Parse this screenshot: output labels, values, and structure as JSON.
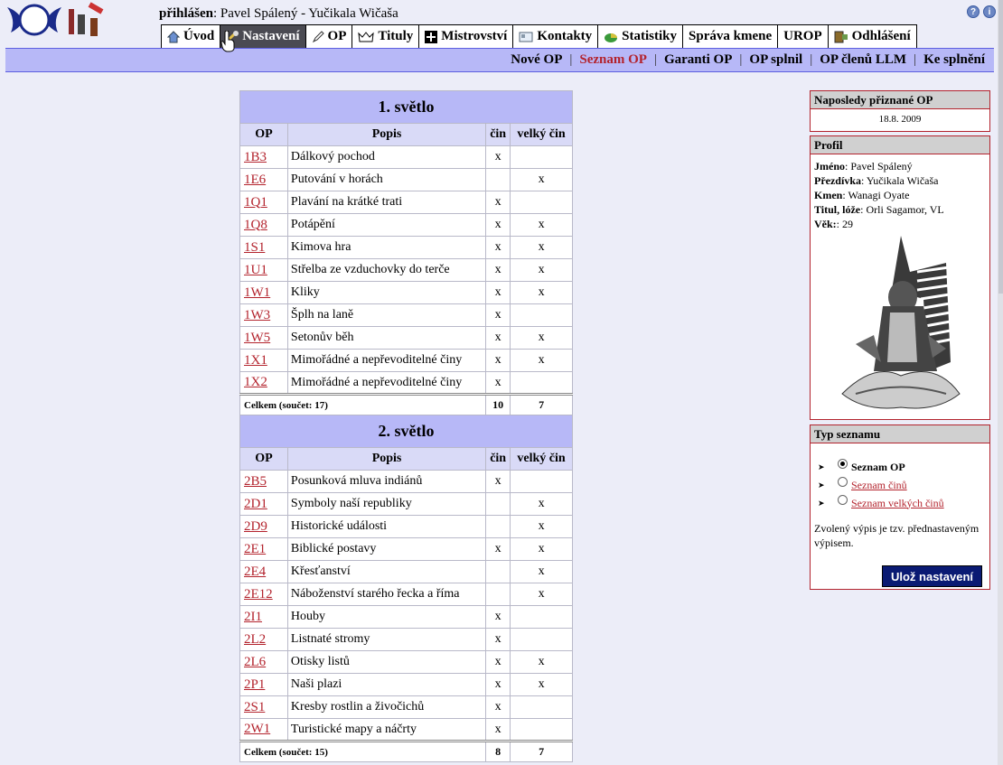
{
  "header": {
    "user_label": "přihlášen",
    "user_name": ": Pavel Spálený - Yučikala Wičaša"
  },
  "main_tabs": [
    {
      "label": "Úvod",
      "icon": "home-icon"
    },
    {
      "label": "Nastavení",
      "icon": "settings-icon"
    },
    {
      "label": "OP",
      "icon": "pencil-icon"
    },
    {
      "label": "Tituly",
      "icon": "crown-icon"
    },
    {
      "label": "Mistrovství",
      "icon": "plus-icon"
    },
    {
      "label": "Kontakty",
      "icon": "card-icon"
    },
    {
      "label": "Statistiky",
      "icon": "pie-chart-icon"
    },
    {
      "label": "Správa kmene",
      "icon": ""
    },
    {
      "label": "UROP",
      "icon": ""
    },
    {
      "label": "Odhlášení",
      "icon": "logout-icon"
    }
  ],
  "subnav": [
    {
      "label": "Nové OP"
    },
    {
      "label": "Seznam OP"
    },
    {
      "label": "Garanti OP"
    },
    {
      "label": "OP splnil"
    },
    {
      "label": "OP členů LLM"
    },
    {
      "label": "Ke splnění"
    }
  ],
  "table": {
    "col_op": "OP",
    "col_desc": "Popis",
    "col_cin": "čin",
    "col_vcin": "velký čin",
    "sections": [
      {
        "title": "1. světlo",
        "rows": [
          {
            "code": "1B3",
            "desc": "Dálkový pochod",
            "cin": "x",
            "vcin": ""
          },
          {
            "code": "1E6",
            "desc": "Putování v horách",
            "cin": "",
            "vcin": "x"
          },
          {
            "code": "1Q1",
            "desc": "Plavání na krátké trati",
            "cin": "x",
            "vcin": ""
          },
          {
            "code": "1Q8",
            "desc": "Potápění",
            "cin": "x",
            "vcin": "x"
          },
          {
            "code": "1S1",
            "desc": "Kimova hra",
            "cin": "x",
            "vcin": "x"
          },
          {
            "code": "1U1",
            "desc": "Střelba ze vzduchovky do terče",
            "cin": "x",
            "vcin": "x"
          },
          {
            "code": "1W1",
            "desc": "Kliky",
            "cin": "x",
            "vcin": "x"
          },
          {
            "code": "1W3",
            "desc": "Šplh na laně",
            "cin": "x",
            "vcin": ""
          },
          {
            "code": "1W5",
            "desc": "Setonův běh",
            "cin": "x",
            "vcin": "x"
          },
          {
            "code": "1X1",
            "desc": "Mimořádné a nepřevoditelné činy",
            "cin": "x",
            "vcin": "x"
          },
          {
            "code": "1X2",
            "desc": "Mimořádné a nepřevoditelné činy",
            "cin": "x",
            "vcin": ""
          }
        ],
        "total_label": "Celkem (součet: 17)",
        "total_cin": "10",
        "total_vcin": "7"
      },
      {
        "title": "2. světlo",
        "rows": [
          {
            "code": "2B5",
            "desc": "Posunková mluva indiánů",
            "cin": "x",
            "vcin": ""
          },
          {
            "code": "2D1",
            "desc": "Symboly naší republiky",
            "cin": "",
            "vcin": "x"
          },
          {
            "code": "2D9",
            "desc": "Historické události",
            "cin": "",
            "vcin": "x"
          },
          {
            "code": "2E1",
            "desc": "Biblické postavy",
            "cin": "x",
            "vcin": "x"
          },
          {
            "code": "2E4",
            "desc": "Křesťanství",
            "cin": "",
            "vcin": "x"
          },
          {
            "code": "2E12",
            "desc": "Náboženství starého řecka a říma",
            "cin": "",
            "vcin": "x"
          },
          {
            "code": "2I1",
            "desc": "Houby",
            "cin": "x",
            "vcin": ""
          },
          {
            "code": "2L2",
            "desc": "Listnaté stromy",
            "cin": "x",
            "vcin": ""
          },
          {
            "code": "2L6",
            "desc": "Otisky listů",
            "cin": "x",
            "vcin": "x"
          },
          {
            "code": "2P1",
            "desc": "Naši plazi",
            "cin": "x",
            "vcin": "x"
          },
          {
            "code": "2S1",
            "desc": "Kresby rostlin a živočichů",
            "cin": "x",
            "vcin": ""
          },
          {
            "code": "2W1",
            "desc": "Turistické mapy a náčrty",
            "cin": "x",
            "vcin": ""
          }
        ],
        "total_label": "Celkem (součet: 15)",
        "total_cin": "8",
        "total_vcin": "7"
      }
    ]
  },
  "panels": {
    "last": {
      "title": "Naposledy přiznané OP",
      "value": "18.8. 2009"
    },
    "profil": {
      "title": "Profil",
      "lines": [
        {
          "label": "Jméno",
          "value": ": Pavel Spálený"
        },
        {
          "label": "Přezdívka",
          "value": ": Yučikala Wičaša"
        },
        {
          "label": "Kmen",
          "value": ": Wanagi Oyate"
        },
        {
          "label": "Titul, lóže",
          "value": ": Orli Sagamor, VL"
        },
        {
          "label": "Věk:",
          "value": ": 29"
        }
      ]
    },
    "typ": {
      "title": "Typ seznamu",
      "options": [
        {
          "label": "Seznam OP"
        },
        {
          "label": "Seznam činů"
        },
        {
          "label": "Seznam velkých činů"
        }
      ],
      "note": "Zvolený výpis je tzv. přednastaveným výpisem.",
      "save_label": "Ulož nastavení"
    }
  },
  "colors": {
    "accent": "#b3232d",
    "nav": "#b7b8f7",
    "button": "#0a1a73"
  }
}
